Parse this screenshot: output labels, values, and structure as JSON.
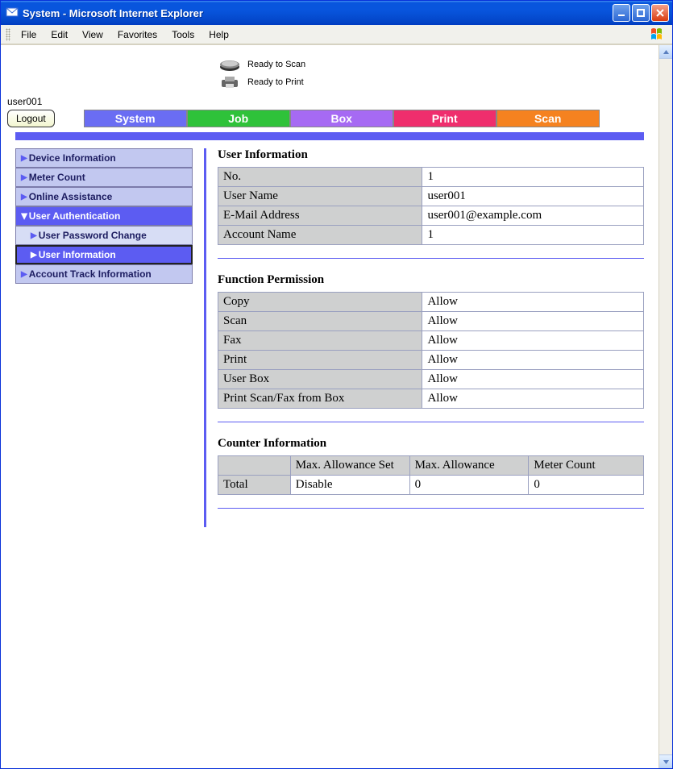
{
  "window": {
    "title": "System - Microsoft Internet Explorer"
  },
  "menubar": {
    "file": "File",
    "edit": "Edit",
    "view": "View",
    "favorites": "Favorites",
    "tools": "Tools",
    "help": "Help"
  },
  "status": {
    "scan": "Ready to Scan",
    "print": "Ready to Print"
  },
  "user_label": "user001",
  "logout": "Logout",
  "tabs": {
    "system": "System",
    "job": "Job",
    "box": "Box",
    "print": "Print",
    "scan": "Scan"
  },
  "sidebar": {
    "device": "Device Information",
    "meter": "Meter Count",
    "online": "Online Assistance",
    "auth": "User Authentication",
    "pwd": "User Password Change",
    "userinfo": "User Information",
    "account": "Account Track Information"
  },
  "sections": {
    "userinfo_title": "User Information",
    "func_title": "Function Permission",
    "counter_title": "Counter Information"
  },
  "userinfo": {
    "no_label": "No.",
    "no_value": "1",
    "name_label": "User Name",
    "name_value": "user001",
    "email_label": "E-Mail Address",
    "email_value": "user001@example.com",
    "acct_label": "Account Name",
    "acct_value": "1"
  },
  "func": {
    "copy_label": "Copy",
    "copy_value": "Allow",
    "scan_label": "Scan",
    "scan_value": "Allow",
    "fax_label": "Fax",
    "fax_value": "Allow",
    "print_label": "Print",
    "print_value": "Allow",
    "box_label": "User Box",
    "box_value": "Allow",
    "psf_label": "Print Scan/Fax from Box",
    "psf_value": "Allow"
  },
  "counter": {
    "col_empty": "",
    "col_set": "Max. Allowance Set",
    "col_allow": "Max. Allowance",
    "col_meter": "Meter Count",
    "row_total": "Total",
    "val_set": "Disable",
    "val_allow": "0",
    "val_meter": "0"
  }
}
